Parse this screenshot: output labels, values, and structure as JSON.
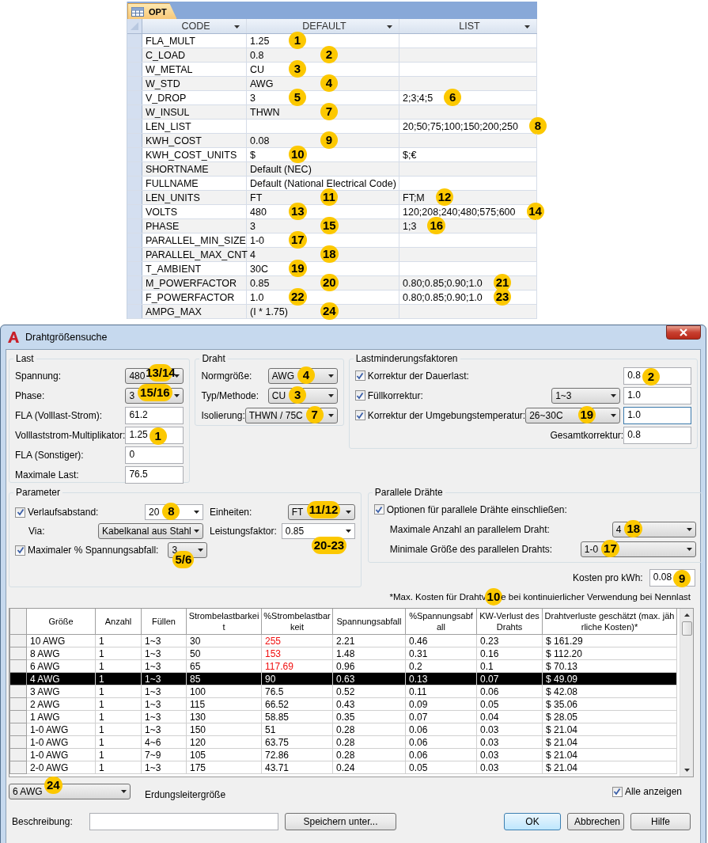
{
  "opt_table": {
    "tab": "OPT",
    "columns": [
      "CODE",
      "DEFAULT",
      "LIST"
    ],
    "rows": [
      {
        "code": "FLA_MULT",
        "default": "1.25",
        "default_badge": "1"
      },
      {
        "code": "C_LOAD",
        "default": "0.8",
        "default_badge": "2"
      },
      {
        "code": "W_METAL",
        "default": "CU",
        "default_badge": "3"
      },
      {
        "code": "W_STD",
        "default": "AWG",
        "default_badge": "4"
      },
      {
        "code": "V_DROP",
        "default": "3",
        "default_badge": "5",
        "list": "2;3;4;5",
        "list_badge": "6"
      },
      {
        "code": "W_INSUL",
        "default": "THWN",
        "default_badge": "7"
      },
      {
        "code": "LEN_LIST",
        "list": "20;50;75;100;150;200;250",
        "list_badge": "8"
      },
      {
        "code": "KWH_COST",
        "default": "0.08",
        "default_badge": "9"
      },
      {
        "code": "KWH_COST_UNITS",
        "default": "$",
        "default_badge": "10",
        "list": "$;€"
      },
      {
        "code": "SHORTNAME",
        "default": "Default (NEC)"
      },
      {
        "code": "FULLNAME",
        "default": "Default (National Electrical Code)"
      },
      {
        "code": "LEN_UNITS",
        "default": "FT",
        "default_badge": "11",
        "list": "FT;M",
        "list_badge": "12"
      },
      {
        "code": "VOLTS",
        "default": "480",
        "default_badge": "13",
        "list": "120;208;240;480;575;600",
        "list_badge": "14"
      },
      {
        "code": "PHASE",
        "default": "3",
        "default_badge": "15",
        "list": "1;3",
        "list_badge": "16"
      },
      {
        "code": "PARALLEL_MIN_SIZE",
        "default": "1-0",
        "default_badge": "17"
      },
      {
        "code": "PARALLEL_MAX_CNT",
        "default": "4",
        "default_badge": "18"
      },
      {
        "code": "T_AMBIENT",
        "default": "30C",
        "default_badge": "19"
      },
      {
        "code": "M_POWERFACTOR",
        "default": "0.85",
        "default_badge": "20",
        "list": "0.80;0.85;0.90;1.0",
        "list_badge": "21"
      },
      {
        "code": "F_POWERFACTOR",
        "default": "1.0",
        "default_badge": "22",
        "list": "0.80;0.85;0.90;1.0",
        "list_badge": "23"
      },
      {
        "code": "AMPG_MAX",
        "default": "(I * 1.75)",
        "default_badge": "24"
      }
    ]
  },
  "dialog": {
    "title": "Drahtgrößensuche",
    "last": {
      "title": "Last",
      "fields": [
        {
          "label": "Spannung:",
          "kind": "combo",
          "value": "480",
          "badge": "13/14"
        },
        {
          "label": "Phase:",
          "kind": "combo",
          "value": "3",
          "badge": "15/16"
        },
        {
          "label": "FLA (Volllast-Strom):",
          "kind": "input",
          "value": "61.2"
        },
        {
          "label": "Volllaststrom-Multiplikator:",
          "kind": "input",
          "value": "1.25",
          "badge": "1"
        },
        {
          "label": "FLA (Sonstiger):",
          "kind": "input",
          "value": "0"
        },
        {
          "label": "Maximale Last:",
          "kind": "input",
          "value": "76.5"
        }
      ]
    },
    "draht": {
      "title": "Draht",
      "fields": [
        {
          "label": "Normgröße:",
          "value": "AWG",
          "badge": "4"
        },
        {
          "label": "Typ/Methode:",
          "value": "CU",
          "badge": "3"
        },
        {
          "label": "Isolierung:",
          "value": "THWN / 75C",
          "badge": "7"
        }
      ]
    },
    "faktoren": {
      "title": "Lastminderungsfaktoren",
      "rows": [
        {
          "label": "Korrektur der Dauerlast:",
          "checked": true,
          "value": "0.8",
          "badge": "2",
          "focused": false
        },
        {
          "label": "Füllkorrektur:",
          "checked": true,
          "combo": "1~3",
          "value": "1.0",
          "focused": false
        },
        {
          "label": "Korrektur der Umgebungstemperatur:",
          "checked": true,
          "combo": "26~30C",
          "combo_badge": "19",
          "value": "1.0",
          "focused": true
        }
      ],
      "total": {
        "label": "Gesamtkorrektur:",
        "value": "0.8"
      }
    },
    "parameter": {
      "title": "Parameter",
      "distance": {
        "label": "Verlaufsabstand:",
        "checked": true,
        "value": "20",
        "badge": "8"
      },
      "units": {
        "label": "Einheiten:",
        "value": "FT",
        "badge": "11/12"
      },
      "via": {
        "label": "Via:",
        "value": "Kabelkanal aus Stahl"
      },
      "power_factor": {
        "label": "Leistungsfaktor:",
        "value": "0.85",
        "badge": "20-23"
      },
      "max_drop": {
        "label": "Maximaler % Spannungsabfall:",
        "checked": true,
        "value": "3",
        "badge": "5/6"
      }
    },
    "parallel": {
      "title": "Parallele Drähte",
      "include": {
        "label": "Optionen für parallele Drähte einschließen:",
        "checked": true
      },
      "max_count": {
        "label": "Maximale Anzahl an parallelem Draht:",
        "value": "4",
        "badge": "18"
      },
      "min_size": {
        "label": "Minimale Größe des parallelen Drahts:",
        "value": "1-0",
        "badge": "17"
      }
    },
    "cost": {
      "label": "Kosten pro kWh:",
      "value": "0.08",
      "badge": "9"
    },
    "note": {
      "before": "*Max. Kosten für Drahtv",
      "badge": "10",
      "after": "e bei kontinuierlicher Verwendung bei Nennlast"
    },
    "grid": {
      "columns": [
        "Größe",
        "Anzahl",
        "Füllen",
        "Strombelastbarkeit",
        "%Strombelastbarkeit",
        "Spannungsabfall",
        "%Spannungsabfall",
        "KW-Verlust des Drahts",
        "Drahtverluste geschätzt (max. jährliche Kosten)*"
      ],
      "rows": [
        {
          "selected": false,
          "overload": true,
          "cells": [
            "10 AWG",
            "1",
            "1~3",
            "30",
            "255",
            "2.21",
            "0.46",
            "0.23",
            "$ 161.29"
          ]
        },
        {
          "selected": false,
          "overload": true,
          "cells": [
            "8 AWG",
            "1",
            "1~3",
            "50",
            "153",
            "1.48",
            "0.31",
            "0.16",
            "$ 112.20"
          ]
        },
        {
          "selected": false,
          "overload": true,
          "cells": [
            "6 AWG",
            "1",
            "1~3",
            "65",
            "117.69",
            "0.96",
            "0.2",
            "0.1",
            "$ 70.13"
          ]
        },
        {
          "selected": true,
          "overload": false,
          "cells": [
            "4 AWG",
            "1",
            "1~3",
            "85",
            "90",
            "0.63",
            "0.13",
            "0.07",
            "$ 49.09"
          ]
        },
        {
          "selected": false,
          "overload": false,
          "cells": [
            "3 AWG",
            "1",
            "1~3",
            "100",
            "76.5",
            "0.52",
            "0.11",
            "0.06",
            "$ 42.08"
          ]
        },
        {
          "selected": false,
          "overload": false,
          "cells": [
            "2 AWG",
            "1",
            "1~3",
            "115",
            "66.52",
            "0.43",
            "0.09",
            "0.05",
            "$ 35.06"
          ]
        },
        {
          "selected": false,
          "overload": false,
          "cells": [
            "1 AWG",
            "1",
            "1~3",
            "130",
            "58.85",
            "0.35",
            "0.07",
            "0.04",
            "$ 28.05"
          ]
        },
        {
          "selected": false,
          "overload": false,
          "cells": [
            "1-0 AWG",
            "1",
            "1~3",
            "150",
            "51",
            "0.28",
            "0.06",
            "0.03",
            "$ 21.04"
          ]
        },
        {
          "selected": false,
          "overload": false,
          "cells": [
            "1-0 AWG",
            "1",
            "4~6",
            "120",
            "63.75",
            "0.28",
            "0.06",
            "0.03",
            "$ 21.04"
          ]
        },
        {
          "selected": false,
          "overload": false,
          "cells": [
            "1-0 AWG",
            "1",
            "7~9",
            "105",
            "72.86",
            "0.28",
            "0.06",
            "0.03",
            "$ 21.04"
          ]
        },
        {
          "selected": false,
          "overload": false,
          "cells": [
            "2-0 AWG",
            "1",
            "1~3",
            "175",
            "43.71",
            "0.24",
            "0.05",
            "0.03",
            "$ 21.04"
          ]
        }
      ]
    },
    "ground": {
      "value": "6 AWG",
      "badge": "24",
      "label": "Erdungsleitergröße"
    },
    "show_all": {
      "label": "Alle anzeigen",
      "checked": true
    },
    "description": {
      "label": "Beschreibung:"
    },
    "buttons": [
      {
        "label": "Speichern unter...",
        "kind": "save"
      },
      {
        "label": "OK",
        "kind": "default"
      },
      {
        "label": "Abbrechen",
        "kind": "normal"
      },
      {
        "label": "Hilfe",
        "kind": "normal"
      }
    ]
  }
}
